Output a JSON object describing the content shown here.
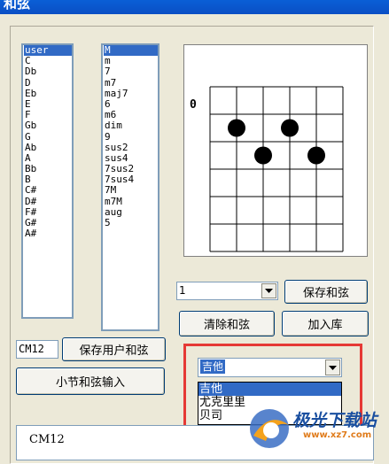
{
  "window": {
    "title": "和弦"
  },
  "roots": [
    "user",
    "C",
    "Db",
    "D",
    "Eb",
    "E",
    "F",
    "Gb",
    "G",
    "Ab",
    "A",
    "Bb",
    "B",
    "C#",
    "D#",
    "F#",
    "G#",
    "A#"
  ],
  "roots_selected": "user",
  "types": [
    "M",
    "m",
    "7",
    "m7",
    "maj7",
    "6",
    "m6",
    "dim",
    "9",
    "sus2",
    "sus4",
    "7sus2",
    "7sus4",
    "7M",
    "m7M",
    "aug",
    "5"
  ],
  "types_selected": "M",
  "chord_name_input": {
    "value": "CM12"
  },
  "buttons": {
    "save_user_chord": "保存用户和弦",
    "bar_chord_input": "小节和弦输入",
    "save_chord": "保存和弦",
    "clear_chord": "清除和弦",
    "add_to_library": "加入库"
  },
  "fret_select": {
    "value": "1"
  },
  "instrument_select": {
    "value": "吉他",
    "options": [
      "吉他",
      "尤克里里",
      "贝司"
    ],
    "selected_option": "吉他"
  },
  "diagram": {
    "fret_label": "0"
  },
  "chord_text": "CM12",
  "watermark": {
    "name": "极光下载站",
    "url": "www.xz7.com"
  }
}
